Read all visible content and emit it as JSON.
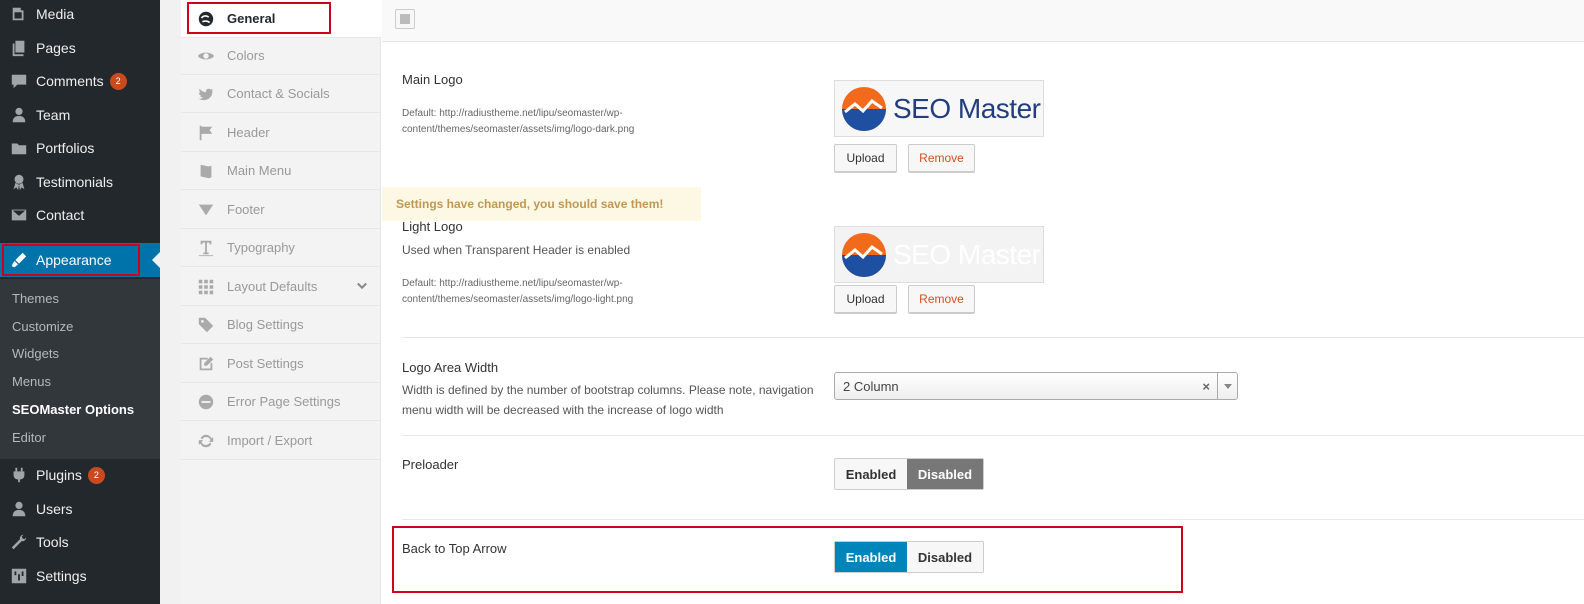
{
  "wp_menu": {
    "items": [
      {
        "label": "Media",
        "icon": "media-icon"
      },
      {
        "label": "Pages",
        "icon": "pages-icon"
      },
      {
        "label": "Comments",
        "icon": "comments-icon",
        "badge": "2"
      },
      {
        "label": "Team",
        "icon": "team-icon"
      },
      {
        "label": "Portfolios",
        "icon": "portfolios-icon"
      },
      {
        "label": "Testimonials",
        "icon": "testimonials-icon"
      },
      {
        "label": "Contact",
        "icon": "contact-icon"
      },
      {
        "label": "Appearance",
        "icon": "appearance-icon"
      },
      {
        "label": "Plugins",
        "icon": "plugins-icon",
        "badge": "2"
      },
      {
        "label": "Users",
        "icon": "users-icon"
      },
      {
        "label": "Tools",
        "icon": "tools-icon"
      },
      {
        "label": "Settings",
        "icon": "settings-icon"
      }
    ],
    "submenu": [
      "Themes",
      "Customize",
      "Widgets",
      "Menus",
      "SEOMaster Options",
      "Editor"
    ]
  },
  "opt_tabs": [
    {
      "label": "General",
      "icon": "general-icon"
    },
    {
      "label": "Colors",
      "icon": "eye-icon"
    },
    {
      "label": "Contact & Socials",
      "icon": "twitter-icon"
    },
    {
      "label": "Header",
      "icon": "flag-icon"
    },
    {
      "label": "Main Menu",
      "icon": "book-icon"
    },
    {
      "label": "Footer",
      "icon": "triangle-down-icon"
    },
    {
      "label": "Typography",
      "icon": "text-icon"
    },
    {
      "label": "Layout Defaults",
      "icon": "grid-icon"
    },
    {
      "label": "Blog Settings",
      "icon": "tags-icon"
    },
    {
      "label": "Post Settings",
      "icon": "edit-icon"
    },
    {
      "label": "Error Page Settings",
      "icon": "minus-circle-icon"
    },
    {
      "label": "Import / Export",
      "icon": "refresh-icon"
    }
  ],
  "notice": "Settings have changed, you should save them!",
  "main_logo": {
    "title": "Main Logo",
    "default_text": "Default: http://radiustheme.net/lipu/seomaster/wp-content/themes/seomaster/assets/img/logo-dark.png",
    "logo_text": "SEO Master",
    "upload": "Upload",
    "remove": "Remove"
  },
  "light_logo": {
    "title": "Light Logo",
    "desc": "Used when Transparent Header is enabled",
    "default_text": "Default: http://radiustheme.net/lipu/seomaster/wp-content/themes/seomaster/assets/img/logo-light.png",
    "logo_text": "SEO Master",
    "upload": "Upload",
    "remove": "Remove"
  },
  "logo_width": {
    "title": "Logo Area Width",
    "desc": "Width is defined by the number of bootstrap columns. Please note, navigation menu width will be decreased with the increase of logo width",
    "value": "2 Column",
    "clear": "×"
  },
  "preloader": {
    "title": "Preloader",
    "enabled": "Enabled",
    "disabled": "Disabled",
    "selected": "disabled"
  },
  "back_to_top": {
    "title": "Back to Top Arrow",
    "enabled": "Enabled",
    "disabled": "Disabled",
    "selected": "enabled"
  },
  "colors": {
    "wp_dark": "#23282d",
    "wp_blue": "#0073aa",
    "highlight": "#d0021b",
    "badge": "#ca4a1f",
    "logo_orange": "#f26b1d",
    "logo_blue": "#1f4fa0"
  }
}
